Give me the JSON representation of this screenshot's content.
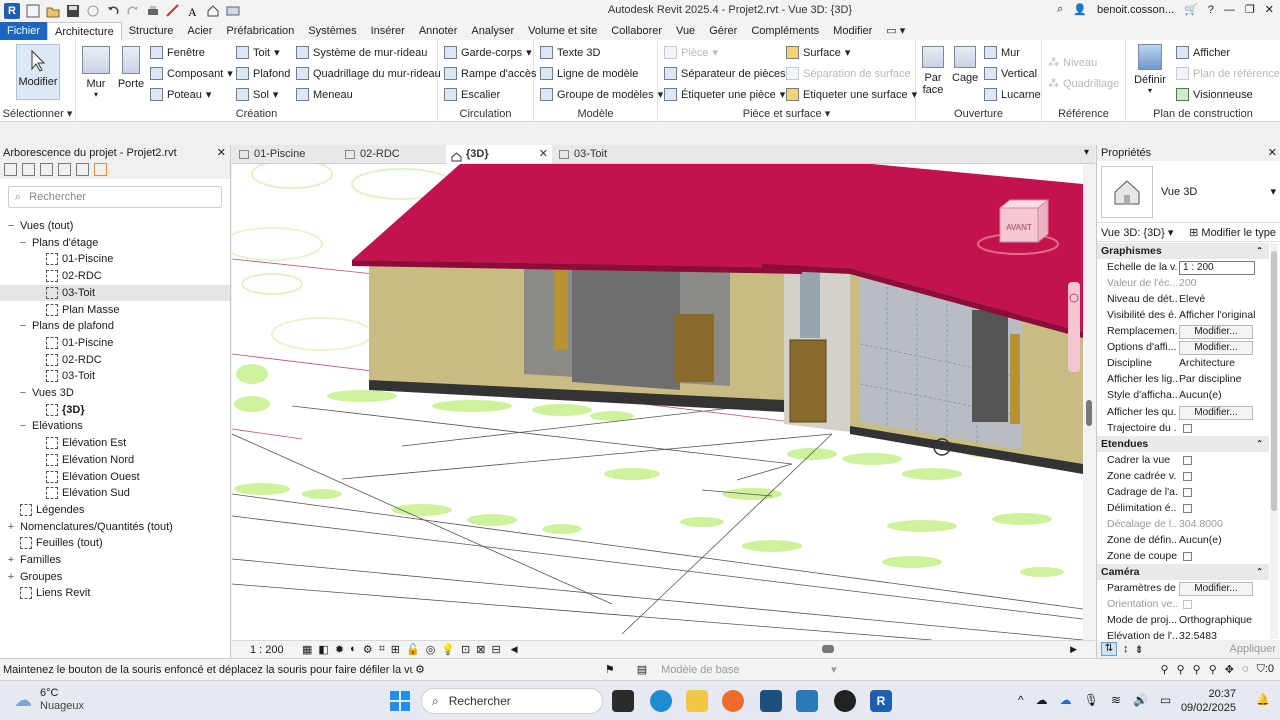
{
  "window": {
    "title": "Autodesk Revit 2025.4 - Projet2.rvt - Vue 3D: {3D}",
    "user": "benoit.cosson...",
    "help": "?",
    "app_letter": "R"
  },
  "menu": [
    "Fichier",
    "Architecture",
    "Structure",
    "Acier",
    "Préfabrication",
    "Systèmes",
    "Insérer",
    "Annoter",
    "Analyser",
    "Volume et site",
    "Collaborer",
    "Vue",
    "Gérer",
    "Compléments",
    "Modifier"
  ],
  "ribbon": {
    "select": {
      "modify": "Modifier",
      "label": "Sélectionner"
    },
    "build": {
      "mur": "Mur",
      "porte": "Porte",
      "fenetre": "Fenêtre",
      "composant": "Composant",
      "poteau": "Poteau",
      "toit": "Toit",
      "plafond": "Plafond",
      "sol": "Sol",
      "sys_mur_rideau": "Système de mur-rideau",
      "quad_mur_rideau": "Quadrillage du mur-rideau",
      "meneau": "Meneau",
      "label": "Création"
    },
    "circulation": {
      "garde_corps": "Garde-corps",
      "rampe": "Rampe d'accès",
      "escalier": "Escalier",
      "label": "Circulation"
    },
    "model": {
      "texte3d": "Texte 3D",
      "ligne_modele": "Ligne de modèle",
      "groupe_modeles": "Groupe de modèles",
      "label": "Modèle"
    },
    "room": {
      "piece": "Pièce",
      "separateur": "Séparateur de pièces",
      "etiq_piece": "Étiqueter une pièce",
      "surface": "Surface",
      "sep_surface": "Séparation de surface",
      "etiq_surface": "Etiqueter une surface",
      "label": "Pièce et surface"
    },
    "opening": {
      "par_face": "Par face",
      "cage": "Cage",
      "mur": "Mur",
      "vertical": "Vertical",
      "lucarne": "Lucarne",
      "label": "Ouverture"
    },
    "datum": {
      "niveau": "Niveau",
      "quadrillage": "Quadrillage",
      "label": "Référence"
    },
    "workplane": {
      "definir": "Définir",
      "afficher": "Afficher",
      "plan_ref": "Plan de référence",
      "visionneuse": "Visionneuse",
      "label": "Plan de construction"
    }
  },
  "project_browser": {
    "title": "Arborescence du projet - Projet2.rvt",
    "search_placeholder": "Rechercher",
    "tree": [
      {
        "text": "Vues (tout)",
        "level": 0,
        "toggle": "−"
      },
      {
        "text": "Plans d'étage",
        "level": 1,
        "toggle": "−"
      },
      {
        "text": "01-Piscine",
        "level": 2,
        "toggle": ""
      },
      {
        "text": "02-RDC",
        "level": 2,
        "toggle": ""
      },
      {
        "text": "03-Toit",
        "level": 2,
        "toggle": ""
      },
      {
        "text": "Plan Masse",
        "level": 2,
        "toggle": ""
      },
      {
        "text": "Plans de plafond",
        "level": 1,
        "toggle": "−"
      },
      {
        "text": "01-Piscine",
        "level": 2,
        "toggle": ""
      },
      {
        "text": "02-RDC",
        "level": 2,
        "toggle": ""
      },
      {
        "text": "03-Toit",
        "level": 2,
        "toggle": ""
      },
      {
        "text": "Vues 3D",
        "level": 1,
        "toggle": "−"
      },
      {
        "text": "{3D}",
        "level": 2,
        "toggle": "",
        "bold": true
      },
      {
        "text": "Elévations",
        "level": 1,
        "toggle": "−"
      },
      {
        "text": "Elévation Est",
        "level": 2,
        "toggle": ""
      },
      {
        "text": "Elévation Nord",
        "level": 2,
        "toggle": ""
      },
      {
        "text": "Elévation Ouest",
        "level": 2,
        "toggle": ""
      },
      {
        "text": "Elévation Sud",
        "level": 2,
        "toggle": ""
      },
      {
        "text": "Légendes",
        "level": 0,
        "toggle": ""
      },
      {
        "text": "Nomenclatures/Quantités (tout)",
        "level": 0,
        "toggle": "+"
      },
      {
        "text": "Feuilles (tout)",
        "level": 0,
        "toggle": ""
      },
      {
        "text": "Familles",
        "level": 0,
        "toggle": "+"
      },
      {
        "text": "Groupes",
        "level": 0,
        "toggle": "+"
      },
      {
        "text": "Liens Revit",
        "level": 0,
        "toggle": ""
      }
    ]
  },
  "view_tabs": [
    {
      "label": "01-Piscine",
      "active": false
    },
    {
      "label": "02-RDC",
      "active": false
    },
    {
      "label": "{3D}",
      "active": true
    },
    {
      "label": "03-Toit",
      "active": false
    }
  ],
  "view_bar": {
    "scale": "1 : 200"
  },
  "viewcube": {
    "face": "AVANT"
  },
  "properties": {
    "title": "Propriétés",
    "type_name": "Vue 3D",
    "selector": "Vue 3D: {3D}",
    "edit_type": "Modifier le type",
    "rows": [
      {
        "kind": "section",
        "key": "Graphismes"
      },
      {
        "kind": "input",
        "key": "Echelle de la v...",
        "value": "1 : 200"
      },
      {
        "kind": "grey",
        "key": "Valeur de l'éc...",
        "value": "200"
      },
      {
        "kind": "text",
        "key": "Niveau de dét...",
        "value": "Elevé"
      },
      {
        "kind": "text",
        "key": "Visibilité des é...",
        "value": "Afficher l'original"
      },
      {
        "kind": "button",
        "key": "Remplacemen...",
        "value": "Modifier..."
      },
      {
        "kind": "button",
        "key": "Options d'affi...",
        "value": "Modifier..."
      },
      {
        "kind": "text",
        "key": "Discipline",
        "value": "Architecture"
      },
      {
        "kind": "text",
        "key": "Afficher les lig...",
        "value": "Par discipline"
      },
      {
        "kind": "text",
        "key": "Style d'afficha...",
        "value": "Aucun(e)"
      },
      {
        "kind": "button",
        "key": "Afficher les qu...",
        "value": "Modifier..."
      },
      {
        "kind": "check",
        "key": "Trajectoire du ..."
      },
      {
        "kind": "section",
        "key": "Etendues"
      },
      {
        "kind": "check",
        "key": "Cadrer la vue"
      },
      {
        "kind": "check",
        "key": "Zone cadrée v..."
      },
      {
        "kind": "check",
        "key": "Cadrage de l'a..."
      },
      {
        "kind": "check",
        "key": "Délimitation é..."
      },
      {
        "kind": "grey",
        "key": "Décalage de l...",
        "value": "304.8000"
      },
      {
        "kind": "text",
        "key": "Zone de défin...",
        "value": "Aucun(e)"
      },
      {
        "kind": "check",
        "key": "Zone de coupe"
      },
      {
        "kind": "section",
        "key": "Caméra"
      },
      {
        "kind": "button",
        "key": "Paramètres de...",
        "value": "Modifier..."
      },
      {
        "kind": "greycheck",
        "key": "Orientation ve..."
      },
      {
        "kind": "text",
        "key": "Mode de proj...",
        "value": "Orthographique"
      },
      {
        "kind": "text",
        "key": "Elévation de l'...",
        "value": "32.5483"
      }
    ],
    "apply": "Appliquer"
  },
  "status": {
    "message": "Maintenez le bouton de la souris enfoncé et déplacez la souris pour faire défiler la vue. Ma",
    "model": "Modèle de base",
    "filter_count": ":0"
  },
  "taskbar": {
    "weather_temp": "6°C",
    "weather_desc": "Nuageux",
    "search": "Rechercher",
    "time": "20:37",
    "date": "09/02/2025"
  },
  "colors": {
    "roof": "#c2134f",
    "wall": "#c8bb7f",
    "accent": "#1966c5",
    "vegetation": "#b8ef7a"
  }
}
